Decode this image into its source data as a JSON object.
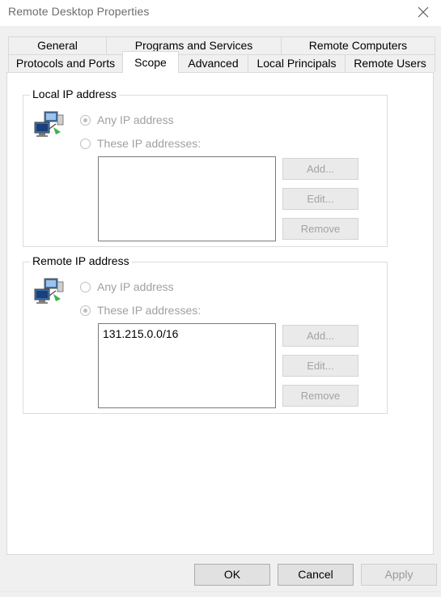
{
  "window": {
    "title": "Remote Desktop Properties",
    "close_icon": "close-icon"
  },
  "tabs": {
    "row_top": [
      {
        "label": "General"
      },
      {
        "label": "Programs and Services"
      },
      {
        "label": "Remote Computers"
      }
    ],
    "row_bottom": [
      {
        "label": "Protocols and Ports"
      },
      {
        "label": "Scope",
        "selected": true
      },
      {
        "label": "Advanced"
      },
      {
        "label": "Local Principals"
      },
      {
        "label": "Remote Users"
      }
    ]
  },
  "local_ip": {
    "label": "Local IP address",
    "icon": "network-computers-icon",
    "option_any": "Any IP address",
    "option_these": "These IP addresses:",
    "selected": "any",
    "entries": [],
    "add": "Add...",
    "edit": "Edit...",
    "remove": "Remove"
  },
  "remote_ip": {
    "label": "Remote IP address",
    "icon": "network-computers-icon",
    "option_any": "Any IP address",
    "option_these": "These IP addresses:",
    "selected": "these",
    "entries": [
      "131.215.0.0/16"
    ],
    "add": "Add...",
    "edit": "Edit...",
    "remove": "Remove"
  },
  "footer": {
    "ok": "OK",
    "cancel": "Cancel",
    "apply": "Apply"
  },
  "colors": {
    "disabled_text": "#a0a0a0",
    "panel": "#ffffff",
    "background": "#f0f0f0"
  }
}
